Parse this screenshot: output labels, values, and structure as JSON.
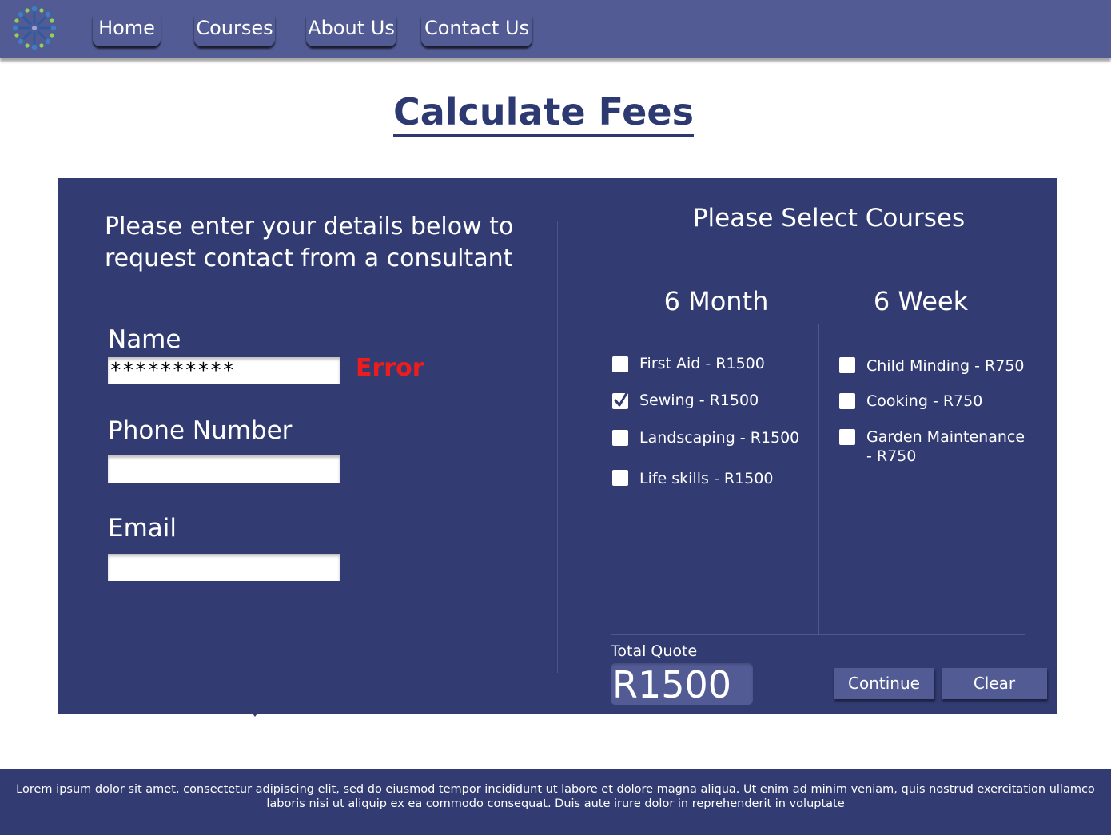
{
  "nav": {
    "logo_icon": "people-circle-logo-icon",
    "items": [
      {
        "label": "Home"
      },
      {
        "label": "Courses"
      },
      {
        "label": "About Us"
      },
      {
        "label": "Contact Us"
      }
    ]
  },
  "page": {
    "title": "Calculate Fees"
  },
  "form": {
    "intro": "Please enter your details below to request contact from a consultant",
    "name": {
      "label": "Name",
      "value": "**********",
      "error": "Error"
    },
    "phone": {
      "label": "Phone Number",
      "value": "",
      "placeholder": ""
    },
    "email": {
      "label": "Email",
      "value": "",
      "placeholder": ""
    }
  },
  "courses": {
    "title": "Please Select Courses",
    "six_month": {
      "heading": "6 Month",
      "items": [
        {
          "label": "First Aid - R1500",
          "checked": false
        },
        {
          "label": "Sewing - R1500",
          "checked": true
        },
        {
          "label": "Landscaping - R1500",
          "checked": false
        },
        {
          "label": "Life skills - R1500",
          "checked": false
        }
      ]
    },
    "six_week": {
      "heading": "6 Week",
      "items": [
        {
          "label": "Child Minding - R750",
          "checked": false
        },
        {
          "label": "Cooking - R750",
          "checked": false
        },
        {
          "label": "Garden Maintenance - R750",
          "checked": false
        }
      ]
    }
  },
  "quote": {
    "label": "Total Quote",
    "value": "R1500"
  },
  "actions": {
    "continue_label": "Continue",
    "clear_label": "Clear"
  },
  "footer": {
    "text": "Lorem ipsum dolor sit amet, consectetur adipiscing elit, sed do eiusmod tempor incididunt ut labore et dolore magna aliqua. Ut enim ad minim veniam, quis nostrud exercitation ullamco laboris nisi ut aliquip ex ea commodo consequat. Duis aute irure dolor in reprehenderit in voluptate"
  },
  "colors": {
    "nav_bg": "#525b94",
    "panel_bg": "#323c72",
    "title": "#2d3a72",
    "error": "#ee1c1c"
  }
}
